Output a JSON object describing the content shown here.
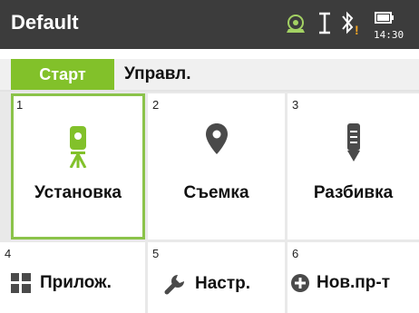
{
  "header": {
    "title": "Default",
    "time": "14:30",
    "icons": [
      "target-icon",
      "cursor-i-icon",
      "bluetooth-warning-icon",
      "battery-icon"
    ],
    "accent_color": "#82c12a"
  },
  "tabs": [
    {
      "label": "Старт",
      "active": true
    },
    {
      "label": "Управл.",
      "active": false
    }
  ],
  "tiles": [
    {
      "number": "1",
      "label": "Установка",
      "icon": "total-station-icon",
      "selected": true
    },
    {
      "number": "2",
      "label": "Съемка",
      "icon": "map-pin-icon",
      "selected": false
    },
    {
      "number": "3",
      "label": "Разбивка",
      "icon": "stakeout-pole-icon",
      "selected": false
    },
    {
      "number": "4",
      "label": "Прилож.",
      "icon": "apps-grid-icon",
      "selected": false
    },
    {
      "number": "5",
      "label": "Настр.",
      "icon": "wrench-icon",
      "selected": false
    },
    {
      "number": "6",
      "label": "Нов.пр-т",
      "icon": "plus-circle-icon",
      "selected": false
    }
  ]
}
